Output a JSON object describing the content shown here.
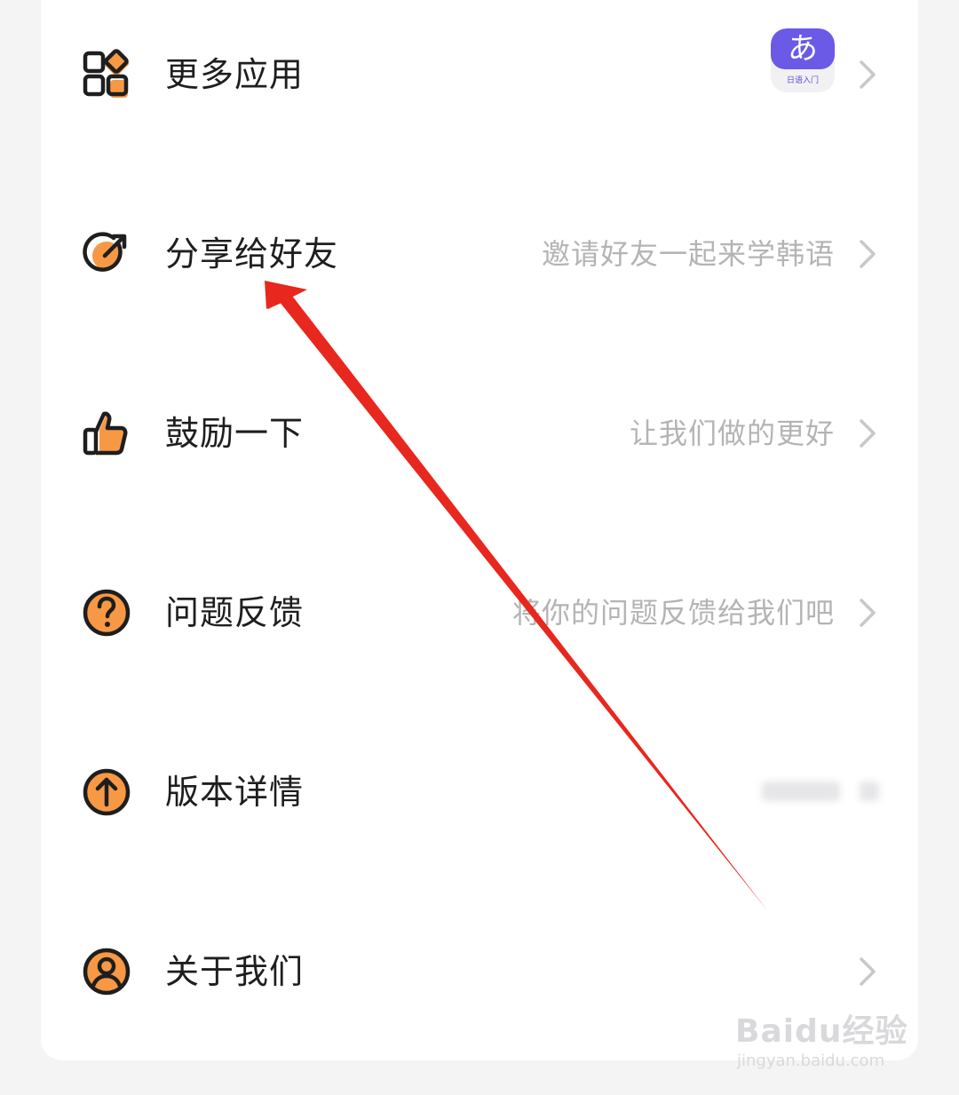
{
  "colors": {
    "accent_orange": "#f79845",
    "icon_stroke": "#1e1e1e",
    "arrow_red": "#e8271e",
    "app_badge_purple": "#6b5ae6"
  },
  "menu": [
    {
      "icon": "grid-apps-icon",
      "label": "更多应用",
      "desc": ""
    },
    {
      "icon": "share-icon",
      "label": "分享给好友",
      "desc": "邀请好友一起来学韩语"
    },
    {
      "icon": "thumbs-up-icon",
      "label": "鼓励一下",
      "desc": "让我们做的更好"
    },
    {
      "icon": "question-icon",
      "label": "问题反馈",
      "desc": "将你的问题反馈给我们吧"
    },
    {
      "icon": "upload-arrow-icon",
      "label": "版本详情",
      "desc": ""
    },
    {
      "icon": "user-icon",
      "label": "关于我们",
      "desc": ""
    }
  ],
  "app_badge": {
    "glyph": "あ",
    "caption": "日语入门"
  },
  "watermark": {
    "main": "Baidu经验",
    "sub": "jingyan.baidu.com"
  }
}
